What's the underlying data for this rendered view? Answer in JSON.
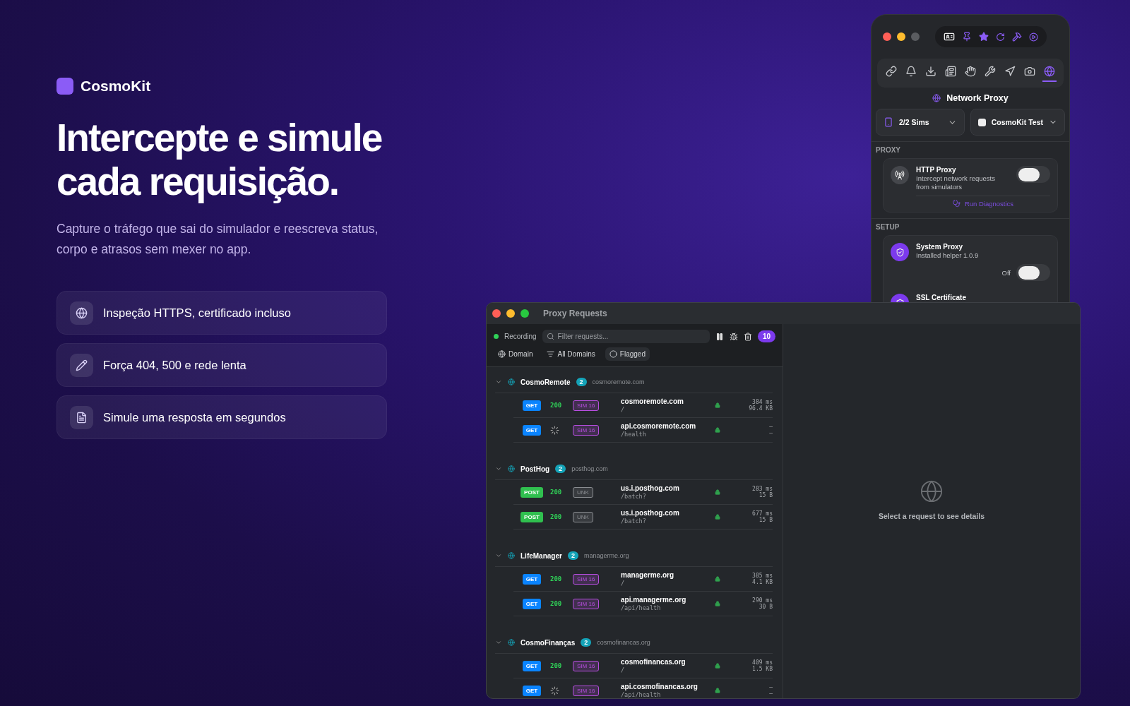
{
  "brand": {
    "name": "CosmoKit"
  },
  "hero": {
    "title_lines": [
      "Intercepte e simule",
      "cada requisição."
    ],
    "subtitle": "Capture o tráfego que sai do simulador e reescreva status, corpo e atrasos sem mexer no app."
  },
  "features": [
    {
      "kind": "globe",
      "text": "Inspeção HTTPS, certificado incluso"
    },
    {
      "kind": "pencil",
      "text": "Força 404, 500 e rede lenta"
    },
    {
      "kind": "memo",
      "text": "Simule uma resposta em segundos"
    }
  ],
  "panel": {
    "tabs": [
      {
        "kind": "link",
        "selected": false
      },
      {
        "kind": "bell",
        "selected": false
      },
      {
        "kind": "inbox",
        "selected": false
      },
      {
        "kind": "news",
        "selected": false
      },
      {
        "kind": "hand",
        "selected": false
      },
      {
        "kind": "tools",
        "selected": false
      },
      {
        "kind": "location",
        "selected": false
      },
      {
        "kind": "camera",
        "selected": false
      },
      {
        "kind": "globe",
        "selected": true
      }
    ],
    "title": "Network Proxy",
    "sims": "2/2 Sims",
    "project": "CosmoKit Test",
    "proxy_heading": "PROXY",
    "http_proxy": {
      "title": "HTTP Proxy",
      "subtitle": "Intercept network requests from simulators",
      "on": false,
      "action": "Run Diagnostics"
    },
    "setup_heading": "SETUP",
    "system_proxy": {
      "title": "System Proxy",
      "subtitle": "Installed helper 1.0.9",
      "status": "Off",
      "on": false
    },
    "ssl": {
      "title": "SSL Certificate"
    }
  },
  "requests_window": {
    "title": "Proxy Requests",
    "recording": {
      "label": "Recording",
      "on": true
    },
    "filter_placeholder": "Filter requests...",
    "count": "10",
    "filters": [
      {
        "kind": "globe",
        "label": "Domain",
        "selected": false
      },
      {
        "kind": "filter",
        "label": "All Domains",
        "selected": false
      },
      {
        "kind": "circle",
        "label": "Flagged",
        "selected": true
      }
    ],
    "groups": [
      {
        "name": "CosmoRemote",
        "count": "2",
        "domain": "cosmoremote.com",
        "expanded": true,
        "requests": [
          {
            "method": {
              "text": "GET",
              "color": "#0a84ff"
            },
            "loading": false,
            "status": "200",
            "tag": {
              "text": "SIM 16",
              "color": "#b84ee0"
            },
            "host": "cosmoremote.com",
            "path": "/",
            "time": "384 ms",
            "size": "96.4 KB"
          },
          {
            "method": {
              "text": "GET",
              "color": "#0a84ff"
            },
            "loading": true,
            "tag": {
              "text": "SIM 16",
              "color": "#b84ee0"
            },
            "host": "api.cosmoremote.com",
            "path": "/health",
            "time": "–",
            "size": "–"
          }
        ]
      },
      {
        "name": "PostHog",
        "count": "2",
        "domain": "posthog.com",
        "expanded": true,
        "requests": [
          {
            "method": {
              "text": "POST",
              "color": "#30c04f"
            },
            "loading": false,
            "status": "200",
            "tag": {
              "text": "UNK",
              "color": "#8a8d91"
            },
            "host": "us.i.posthog.com",
            "path": "/batch?",
            "time": "283 ms",
            "size": "15 B"
          },
          {
            "method": {
              "text": "POST",
              "color": "#30c04f"
            },
            "loading": false,
            "status": "200",
            "tag": {
              "text": "UNK",
              "color": "#8a8d91"
            },
            "host": "us.i.posthog.com",
            "path": "/batch?",
            "time": "677 ms",
            "size": "15 B"
          }
        ]
      },
      {
        "name": "LifeManager",
        "count": "2",
        "domain": "managerme.org",
        "expanded": true,
        "requests": [
          {
            "method": {
              "text": "GET",
              "color": "#0a84ff"
            },
            "loading": false,
            "status": "200",
            "tag": {
              "text": "SIM 16",
              "color": "#b84ee0"
            },
            "host": "managerme.org",
            "path": "/",
            "time": "385 ms",
            "size": "4.1 KB"
          },
          {
            "method": {
              "text": "GET",
              "color": "#0a84ff"
            },
            "loading": false,
            "status": "200",
            "tag": {
              "text": "SIM 16",
              "color": "#b84ee0"
            },
            "host": "api.managerme.org",
            "path": "/api/health",
            "time": "290 ms",
            "size": "30 B"
          }
        ]
      },
      {
        "name": "CosmoFinanças",
        "count": "2",
        "domain": "cosmofinancas.org",
        "expanded": true,
        "requests": [
          {
            "method": {
              "text": "GET",
              "color": "#0a84ff"
            },
            "loading": false,
            "status": "200",
            "tag": {
              "text": "SIM 16",
              "color": "#b84ee0"
            },
            "host": "cosmofinancas.org",
            "path": "/",
            "time": "409 ms",
            "size": "1.5 KB"
          },
          {
            "method": {
              "text": "GET",
              "color": "#0a84ff"
            },
            "loading": true,
            "tag": {
              "text": "SIM 16",
              "color": "#b84ee0"
            },
            "host": "api.cosmofinancas.org",
            "path": "/api/health",
            "time": "–",
            "size": "–"
          }
        ]
      }
    ],
    "empty_text": "Select a request to see details"
  }
}
